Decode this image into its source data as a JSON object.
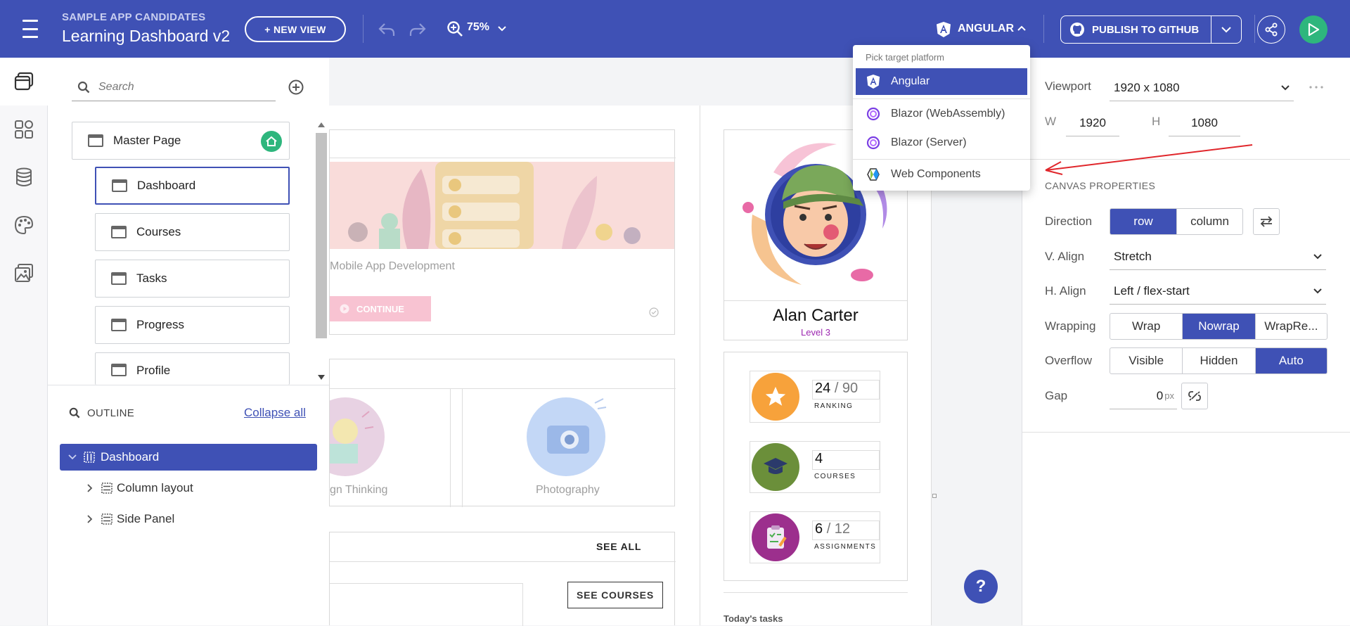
{
  "header": {
    "project_label": "SAMPLE APP CANDIDATES",
    "app_title": "Learning Dashboard v2",
    "new_view_label": "+ NEW VIEW",
    "zoom_label": "75%",
    "platform_label": "ANGULAR",
    "publish_label": "PUBLISH TO GITHUB"
  },
  "pages_panel": {
    "search_placeholder": "Search",
    "master_page": "Master Page",
    "pages": [
      "Dashboard",
      "Courses",
      "Tasks",
      "Progress",
      "Profile"
    ]
  },
  "outline": {
    "title": "OUTLINE",
    "collapse_label": "Collapse all",
    "nodes": [
      "Dashboard",
      "Column layout",
      "Side Panel"
    ]
  },
  "platform_dropdown": {
    "title": "Pick target platform",
    "options": [
      "Angular",
      "Blazor (WebAssembly)",
      "Blazor (Server)",
      "Web Components"
    ],
    "selected": "Angular"
  },
  "canvas": {
    "course_title": "Mobile App Development",
    "continue_label": "CONTINUE",
    "topic_1": "gn Thinking",
    "topic_2": "Photography",
    "see_all_label": "SEE ALL",
    "see_courses_label": "SEE COURSES",
    "profile_name": "Alan Carter",
    "profile_level": "Level 3",
    "stats": [
      {
        "value": "24",
        "total": "/ 90",
        "label": "RANKING"
      },
      {
        "value": "4",
        "total": "",
        "label": "COURSES"
      },
      {
        "value": "6",
        "total": "/ 12",
        "label": "ASSIGNMENTS"
      }
    ],
    "todays_tasks": "Today's tasks"
  },
  "properties": {
    "viewport_label": "Viewport",
    "viewport_value": "1920 x 1080",
    "w_label": "W",
    "w_value": "1920",
    "h_label": "H",
    "h_value": "1080",
    "section_title": "CANVAS PROPERTIES",
    "direction_label": "Direction",
    "direction_options": [
      "row",
      "column"
    ],
    "valign_label": "V. Align",
    "valign_value": "Stretch",
    "halign_label": "H. Align",
    "halign_value": "Left / flex-start",
    "wrapping_label": "Wrapping",
    "wrapping_options": [
      "Wrap",
      "Nowrap",
      "WrapRe..."
    ],
    "overflow_label": "Overflow",
    "overflow_options": [
      "Visible",
      "Hidden",
      "Auto"
    ],
    "gap_label": "Gap",
    "gap_value": "0",
    "gap_unit": "px"
  },
  "help_label": "?",
  "colors": {
    "primary": "#3f51b5",
    "green": "#2eb67d",
    "arrow": "#e0262b"
  }
}
